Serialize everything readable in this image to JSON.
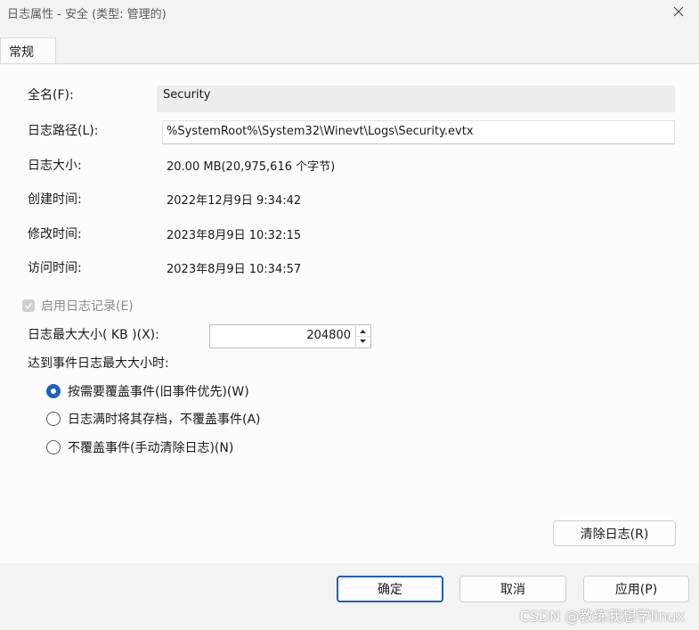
{
  "window": {
    "title": "日志属性 - 安全 (类型: 管理的)"
  },
  "tabs": [
    {
      "label": "常规",
      "active": true
    }
  ],
  "general": {
    "full_name_label": "全名(F):",
    "full_name_value": "Security",
    "log_path_label": "日志路径(L):",
    "log_path_value": "%SystemRoot%\\System32\\Winevt\\Logs\\Security.evtx",
    "log_size_label": "日志大小:",
    "log_size_value": "20.00 MB(20,975,616 个字节)",
    "created_label": "创建时间:",
    "created_value": "2022年12月9日 9:34:42",
    "modified_label": "修改时间:",
    "modified_value": "2023年8月9日 10:32:15",
    "accessed_label": "访问时间:",
    "accessed_value": "2023年8月9日 10:34:57",
    "enable_logging_label": "启用日志记录(E)",
    "enable_logging_checked": true,
    "enable_logging_disabled": true,
    "max_size_label": "日志最大大小( KB )(X):",
    "max_size_value": "204800",
    "when_max_label": "达到事件日志最大大小时:",
    "policy_options": [
      {
        "label": "按需要覆盖事件(旧事件优先)(W)",
        "checked": true
      },
      {
        "label": "日志满时将其存档，不覆盖事件(A)",
        "checked": false
      },
      {
        "label": "不覆盖事件(手动清除日志)(N)",
        "checked": false
      }
    ],
    "clear_log_button": "清除日志(R)"
  },
  "footer": {
    "ok_button": "确定",
    "cancel_button": "取消",
    "apply_button": "应用(P)"
  },
  "watermark": "CSDN @教练我想学linux",
  "colors": {
    "accent": "#1f5fbf",
    "window_bg": "#f3f3f3",
    "panel_bg": "#fcfcfc"
  }
}
